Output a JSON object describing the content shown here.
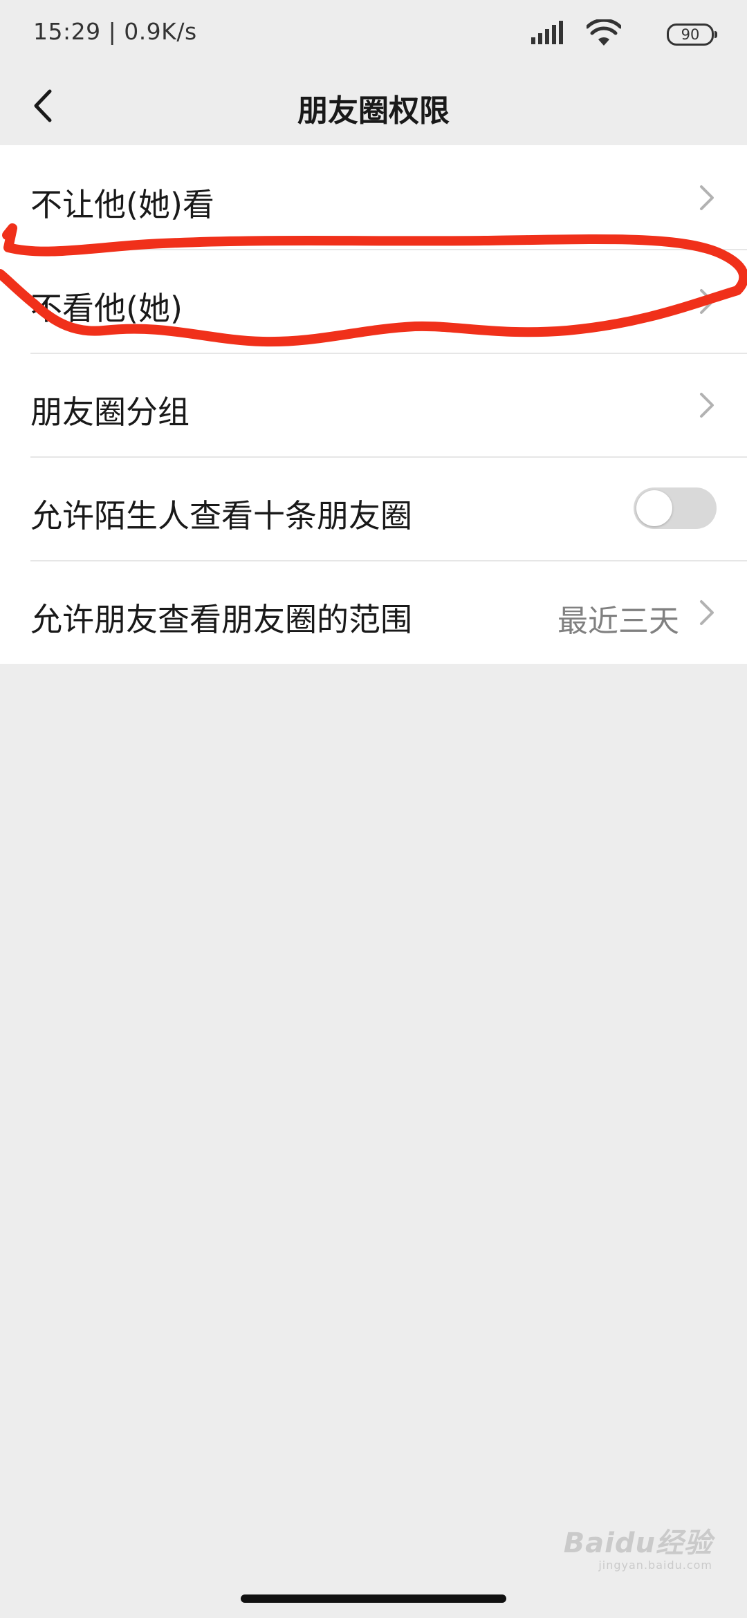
{
  "status_bar": {
    "time_speed": "15:29 | 0.9K/s",
    "battery": "90"
  },
  "nav": {
    "title": "朋友圈权限",
    "back_icon": "chevron-left-icon"
  },
  "rows": [
    {
      "label": "不让他(她)看",
      "value": "",
      "has_chevron": true
    },
    {
      "label": "不看他(她)",
      "value": "",
      "has_chevron": true
    },
    {
      "label": "朋友圈分组",
      "value": "",
      "has_chevron": true
    },
    {
      "label": "允许陌生人查看十条朋友圈",
      "value": "",
      "toggle_on": false
    },
    {
      "label": "允许朋友查看朋友圈的范围",
      "value": "最近三天",
      "has_chevron": true
    }
  ],
  "annotation": {
    "color": "#f0301a"
  },
  "watermark": {
    "logo": "Baidu经验",
    "url": "jingyan.baidu.com"
  },
  "colors": {
    "background": "#ededed",
    "list_background": "#ffffff",
    "toggle_off": "#d9d9d9"
  }
}
